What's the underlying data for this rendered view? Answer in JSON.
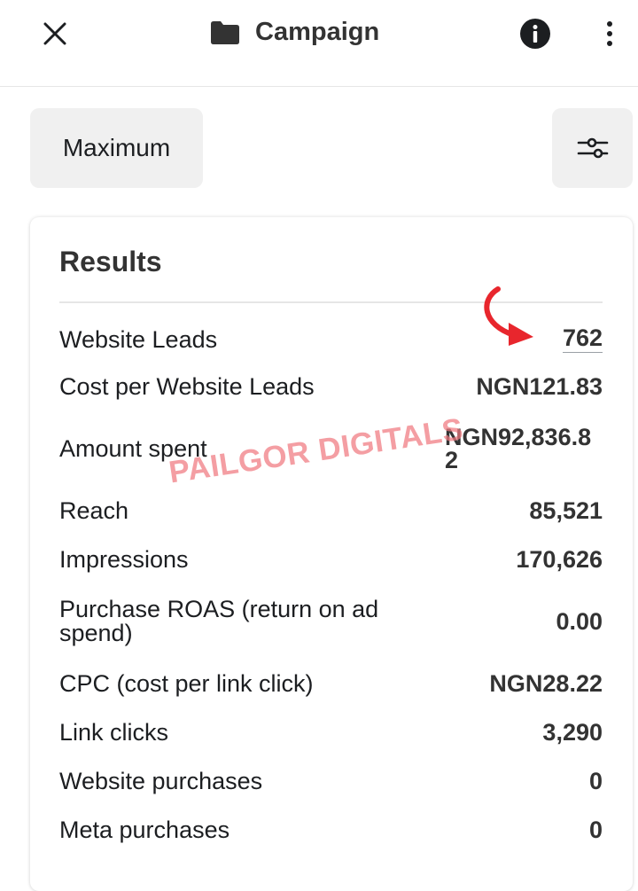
{
  "header": {
    "title": "Campaign",
    "close_icon": "close-icon",
    "folder_icon": "folder-icon",
    "info_icon": "info-icon",
    "more_icon": "more-vertical-icon"
  },
  "toolbar": {
    "date_range_label": "Maximum",
    "filter_icon": "sliders-icon"
  },
  "results": {
    "title": "Results",
    "rows": [
      {
        "label": "Website Leads",
        "value": "762"
      },
      {
        "label": "Cost per Website Leads",
        "value": "NGN121.83"
      },
      {
        "label": "Amount spent",
        "value": "NGN92,836.82"
      },
      {
        "label": "Reach",
        "value": "85,521"
      },
      {
        "label": "Impressions",
        "value": "170,626"
      },
      {
        "label": "Purchase ROAS (return on ad spend)",
        "value": "0.00"
      },
      {
        "label": "CPC (cost per link click)",
        "value": "NGN28.22"
      },
      {
        "label": "Link clicks",
        "value": "3,290"
      },
      {
        "label": "Website purchases",
        "value": "0"
      },
      {
        "label": "Meta purchases",
        "value": "0"
      }
    ]
  },
  "watermark": "PAILGOR DIGITALS",
  "colors": {
    "accent_arrow": "#e8262d",
    "watermark": "#f07880",
    "button_bg": "#f0f0f0",
    "text": "#1c1e21"
  }
}
